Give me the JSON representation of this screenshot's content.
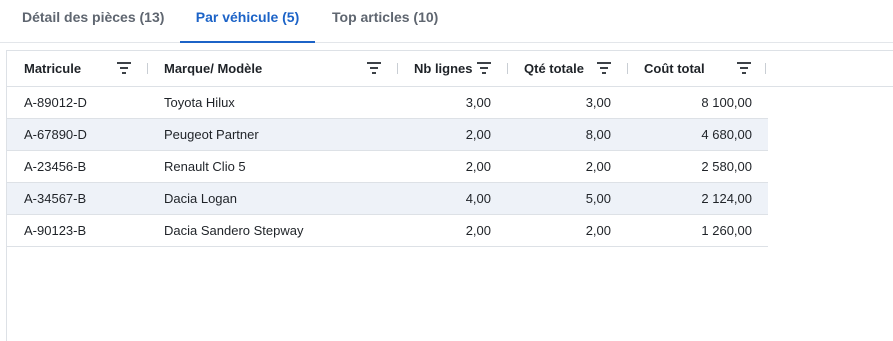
{
  "tabs": [
    {
      "label": "Détail des pièces (13)",
      "active": false
    },
    {
      "label": "Par véhicule (5)",
      "active": true
    },
    {
      "label": "Top articles (10)",
      "active": false
    }
  ],
  "table": {
    "columns": [
      "Matricule",
      "Marque/ Modèle",
      "Nb lignes",
      "Qté totale",
      "Coût total"
    ],
    "rows": [
      {
        "matricule": "A-89012-D",
        "modele": "Toyota Hilux",
        "nb_lignes": "3,00",
        "qte_totale": "3,00",
        "cout_total": "8 100,00"
      },
      {
        "matricule": "A-67890-D",
        "modele": "Peugeot Partner",
        "nb_lignes": "2,00",
        "qte_totale": "8,00",
        "cout_total": "4 680,00"
      },
      {
        "matricule": "A-23456-B",
        "modele": "Renault Clio 5",
        "nb_lignes": "2,00",
        "qte_totale": "2,00",
        "cout_total": "2 580,00"
      },
      {
        "matricule": "A-34567-B",
        "modele": "Dacia Logan",
        "nb_lignes": "4,00",
        "qte_totale": "5,00",
        "cout_total": "2 124,00"
      },
      {
        "matricule": "A-90123-B",
        "modele": "Dacia Sandero Stepway",
        "nb_lignes": "2,00",
        "qte_totale": "2,00",
        "cout_total": "1 260,00"
      }
    ]
  },
  "colors": {
    "accent": "#1c63c7",
    "row_alt": "#eef2f8",
    "border": "#dde1e6"
  }
}
